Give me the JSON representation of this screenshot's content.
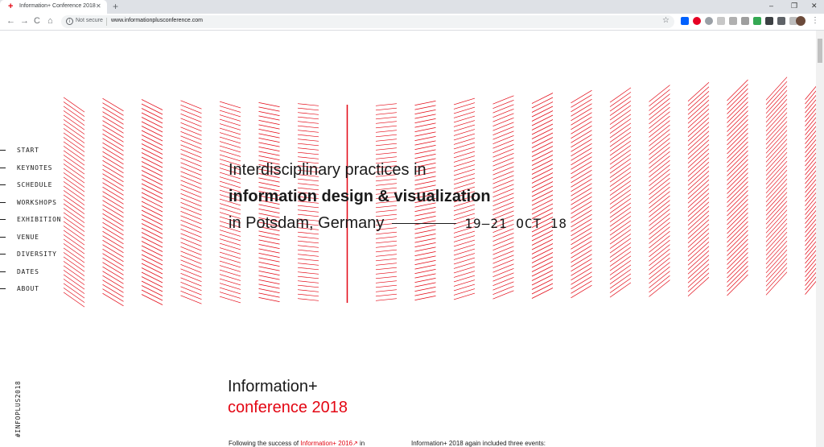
{
  "browser": {
    "tab_title": "Information+ Conference 2018",
    "tab_close": "✕",
    "new_tab": "+",
    "security_label": "Not secure",
    "url": "www.informationplusconference.com",
    "window_buttons": [
      "–",
      "❐",
      "✕"
    ],
    "nav_buttons": [
      "←",
      "→",
      "C",
      "⌂"
    ],
    "extensions": [
      {
        "icon": "dropbox-icon",
        "color": "#0061fe"
      },
      {
        "icon": "pinterest-icon",
        "color": "#e60023"
      },
      {
        "icon": "gray-circle-icon",
        "color": "#9aa0a6"
      },
      {
        "icon": "gray-box-icon",
        "color": "#c7c7c7"
      },
      {
        "icon": "gray-square-icon",
        "color": "#b0b0b0"
      },
      {
        "icon": "gray-g-icon",
        "color": "#9e9e9e"
      },
      {
        "icon": "color-wheel-icon",
        "color": "#34a853"
      },
      {
        "icon": "dark-icon",
        "color": "#3c4043"
      },
      {
        "icon": "mail-icon",
        "color": "#5f6368"
      },
      {
        "icon": "chat-icon",
        "color": "#bdbdbd"
      }
    ]
  },
  "page": {
    "nav": [
      "START",
      "KEYNOTES",
      "SCHEDULE",
      "WORKSHOPS",
      "EXHIBITION",
      "VENUE",
      "DIVERSITY",
      "DATES",
      "ABOUT"
    ],
    "hero": {
      "line1": "Interdisciplinary practices in",
      "line2": "information design & visualization",
      "line3": "in Potsdam, Germany",
      "date": "19–21 OCT 18"
    },
    "hashtag": "#INFOPLUS2018",
    "section": {
      "title": "Information+",
      "subtitle": "conference 2018",
      "para_a_prefix": "Following the success of ",
      "para_a_link": "Information+ 2016↗",
      "para_a_suffix": " in",
      "para_b": "Information+ 2018 again included three events:"
    },
    "colors": {
      "accent": "#e30613",
      "text": "#1a1a1a"
    }
  }
}
